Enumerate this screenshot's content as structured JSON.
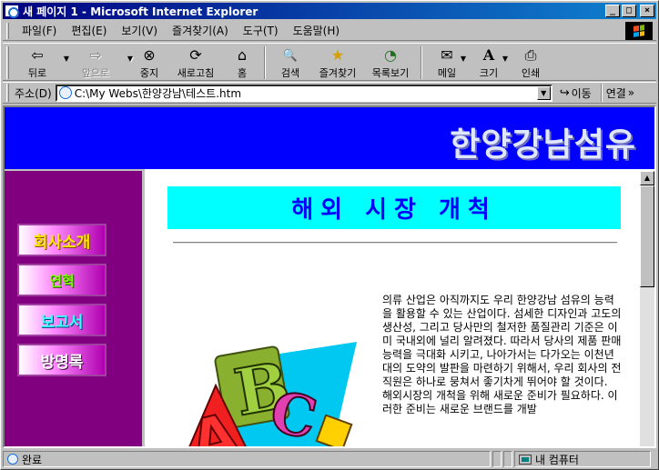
{
  "window": {
    "title": "새 페이지 1 - Microsoft Internet Explorer",
    "controls": {
      "minimize": "_",
      "maximize": "□",
      "close": "×"
    }
  },
  "menubar": {
    "items": [
      "파일(F)",
      "편집(E)",
      "보기(V)",
      "즐겨찾기(A)",
      "도구(T)",
      "도움말(H)"
    ]
  },
  "toolbar": {
    "buttons": [
      {
        "label": "뒤로",
        "icon": "back-arrow-icon",
        "glyph": "⇦",
        "enabled": true
      },
      {
        "label": "앞으로",
        "icon": "forward-arrow-icon",
        "glyph": "⇨",
        "enabled": false
      },
      {
        "label": "중지",
        "icon": "stop-icon",
        "glyph": "⊗",
        "enabled": true
      },
      {
        "label": "새로고침",
        "icon": "refresh-icon",
        "glyph": "⟳",
        "enabled": true
      },
      {
        "label": "홈",
        "icon": "home-icon",
        "glyph": "⌂",
        "enabled": true
      },
      {
        "label": "검색",
        "icon": "search-icon",
        "glyph": "🔍",
        "enabled": true
      },
      {
        "label": "즐겨찾기",
        "icon": "favorites-icon",
        "glyph": "★",
        "enabled": true
      },
      {
        "label": "목록보기",
        "icon": "history-icon",
        "glyph": "◔",
        "enabled": true
      },
      {
        "label": "메일",
        "icon": "mail-icon",
        "glyph": "✉",
        "enabled": true
      },
      {
        "label": "크기",
        "icon": "font-size-icon",
        "glyph": "A",
        "enabled": true
      },
      {
        "label": "인쇄",
        "icon": "print-icon",
        "glyph": "⎙",
        "enabled": true
      }
    ]
  },
  "address": {
    "label": "주소(D)",
    "value": "C:\\My Webs\\한양강남\\테스트.htm",
    "go_label": "이동",
    "links_label": "연결"
  },
  "page": {
    "banner_title": "한양강남섬유",
    "nav": [
      "회사소개",
      "연혁",
      "보고서",
      "방명록"
    ],
    "heading": "해외 시장 개척",
    "paragraph1": "의류 산업은 아직까지도 우리 한양강남 섬유의 능력을 활용할 수 있는 산업이다. 섬세한 디자인과 고도의 생산성, 그리고 당사만의 철저한 품질관리 기준은 이미 국내외에 널리 알려졌다. 따라서 당사의 제품 판매 능력을 극대화 시키고, 나아가서는 다가오는 이천년대의 도약의 발판을 마련하기 위해서, 우리 회사의 전 직원은 하나로 뭉쳐서 좋기차게 뛰어야 할 것이다.",
    "paragraph2": "해외시장의 개척을 위해 새로운 준비가 필요하다. 이러한 준비는 새로운 브랜드를 개발",
    "clipart_letters": [
      "A",
      "B",
      "C"
    ]
  },
  "statusbar": {
    "text": "완료",
    "zone": "내 컴퓨터"
  },
  "colors": {
    "banner": "#0000ff",
    "nav_bg": "#800080",
    "heading_bg": "#00ffff",
    "heading_text": "#0000ff"
  }
}
